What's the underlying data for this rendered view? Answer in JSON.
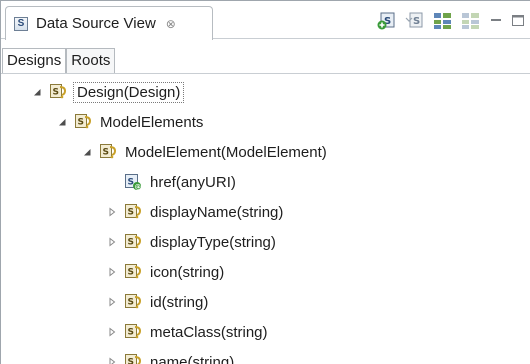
{
  "view": {
    "title": "Data Source View",
    "close_glyph": "⊗"
  },
  "toolbar": {
    "buttons": [
      {
        "name": "add-source-icon"
      },
      {
        "name": "refresh-source-icon"
      },
      {
        "name": "expand-grid-icon"
      },
      {
        "name": "collapse-grid-icon"
      }
    ]
  },
  "sub_tabs": [
    "Designs",
    "Roots"
  ],
  "tree": {
    "nodes": [
      {
        "label": "Design(Design)",
        "depth": 0,
        "expanded": true,
        "icon": "schema-element-icon",
        "selected": true
      },
      {
        "label": "ModelElements",
        "depth": 1,
        "expanded": true,
        "icon": "schema-element-icon"
      },
      {
        "label": "ModelElement(ModelElement)",
        "depth": 2,
        "expanded": true,
        "icon": "schema-element-icon"
      },
      {
        "label": "href(anyURI)",
        "depth": 3,
        "expanded": null,
        "icon": "schema-attribute-icon"
      },
      {
        "label": "displayName(string)",
        "depth": 3,
        "expanded": false,
        "icon": "schema-element-icon"
      },
      {
        "label": "displayType(string)",
        "depth": 3,
        "expanded": false,
        "icon": "schema-element-icon"
      },
      {
        "label": "icon(string)",
        "depth": 3,
        "expanded": false,
        "icon": "schema-element-icon"
      },
      {
        "label": "id(string)",
        "depth": 3,
        "expanded": false,
        "icon": "schema-element-icon"
      },
      {
        "label": "metaClass(string)",
        "depth": 3,
        "expanded": false,
        "icon": "schema-element-icon"
      },
      {
        "label": "name(string)",
        "depth": 3,
        "expanded": false,
        "icon": "schema-element-icon"
      }
    ]
  }
}
